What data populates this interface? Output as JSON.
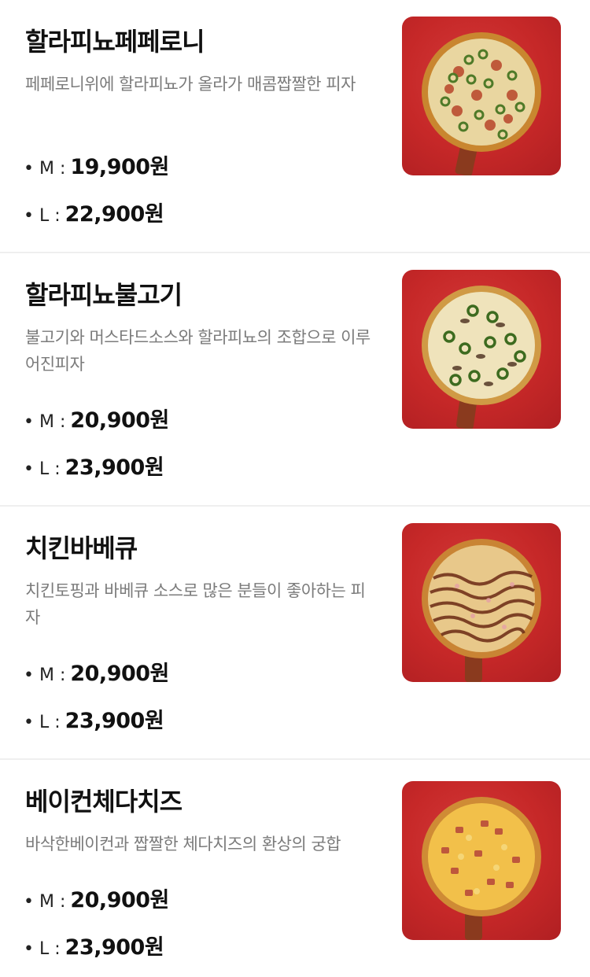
{
  "menu": [
    {
      "name": "할라피뇨페페로니",
      "description": "페페로니위에 할라피뇨가 올라가 매콤짭짤한 피자",
      "prices": [
        {
          "label": "• M :",
          "value": "19,900원"
        },
        {
          "label": "• L :",
          "value": "22,900원"
        }
      ],
      "image_icon": "jalapeno-pepperoni-pizza-photo"
    },
    {
      "name": "할라피뇨불고기",
      "description": "불고기와 머스타드소스와 할라피뇨의 조합으로 이루어진피자",
      "prices": [
        {
          "label": "• M :",
          "value": "20,900원"
        },
        {
          "label": "• L :",
          "value": "23,900원"
        }
      ],
      "image_icon": "jalapeno-bulgogi-pizza-photo"
    },
    {
      "name": "치킨바베큐",
      "description": "치킨토핑과 바베큐 소스로 많은 분들이 좋아하는 피자",
      "prices": [
        {
          "label": "• M :",
          "value": "20,900원"
        },
        {
          "label": "• L :",
          "value": "23,900원"
        }
      ],
      "image_icon": "chicken-bbq-pizza-photo"
    },
    {
      "name": "베이컨체다치즈",
      "description": "바삭한베이컨과 짭짤한 체다치즈의 환상의 궁합",
      "prices": [
        {
          "label": "• M :",
          "value": "20,900원"
        },
        {
          "label": "• L :",
          "value": "23,900원"
        }
      ],
      "image_icon": "bacon-cheddar-pizza-photo"
    }
  ],
  "colors": {
    "photo_background": "#c62828",
    "divider": "#efefef",
    "description_text": "#7b7b7b"
  }
}
